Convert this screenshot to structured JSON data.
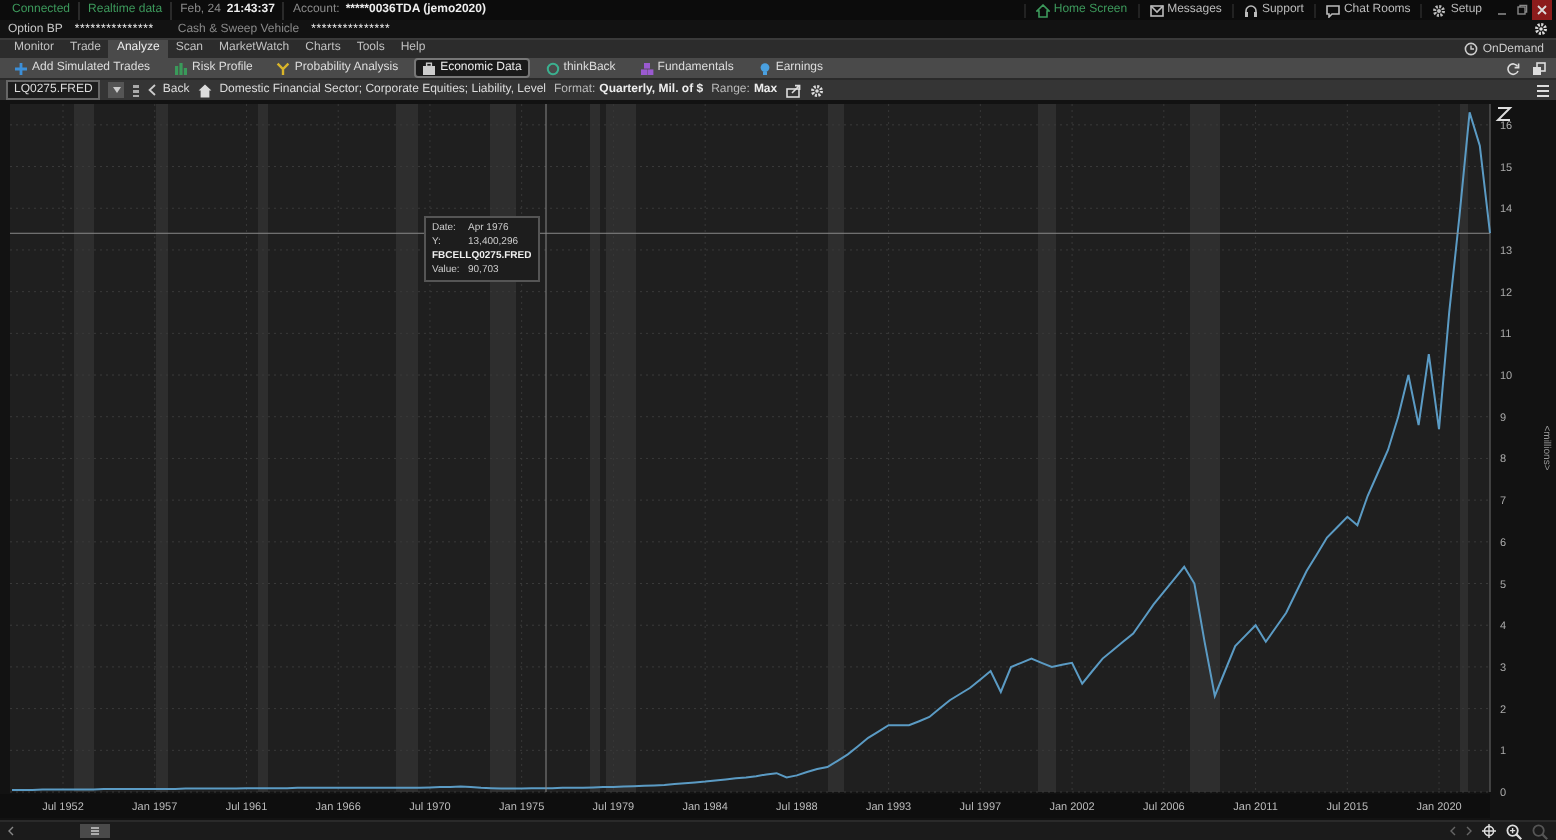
{
  "status_bar": {
    "connection": "Connected",
    "data_feed": "Realtime data",
    "date": "Feb, 24",
    "time": "21:43:37",
    "account_label": "Account:",
    "account": "*****0036TDA (jemo2020)",
    "links": [
      {
        "label": "Home Screen",
        "selected": true
      },
      {
        "label": "Messages",
        "selected": false
      },
      {
        "label": "Support",
        "selected": false
      },
      {
        "label": "Chat Rooms",
        "selected": false
      },
      {
        "label": "Setup",
        "selected": false
      }
    ]
  },
  "account_bar": {
    "fields": [
      {
        "label": "Option BP",
        "value": "***************"
      },
      {
        "label": "Cash & Sweep Vehicle",
        "value": "***************"
      }
    ]
  },
  "tabs": [
    {
      "label": "Monitor",
      "selected": false
    },
    {
      "label": "Trade",
      "selected": false
    },
    {
      "label": "Analyze",
      "selected": true
    },
    {
      "label": "Scan",
      "selected": false
    },
    {
      "label": "MarketWatch",
      "selected": false
    },
    {
      "label": "Charts",
      "selected": false
    },
    {
      "label": "Tools",
      "selected": false
    },
    {
      "label": "Help",
      "selected": false
    }
  ],
  "ondemand": "OnDemand",
  "subtabs": [
    {
      "label": "Add Simulated Trades",
      "selected": false
    },
    {
      "label": "Risk Profile",
      "selected": false
    },
    {
      "label": "Probability Analysis",
      "selected": false
    },
    {
      "label": "Economic Data",
      "selected": true
    },
    {
      "label": "thinkBack",
      "selected": false
    },
    {
      "label": "Fundamentals",
      "selected": false
    },
    {
      "label": "Earnings",
      "selected": false
    }
  ],
  "symbol_bar": {
    "symbol": "LQ0275.FRED",
    "back": "Back",
    "series_title": "Domestic Financial Sector; Corporate Equities; Liability, Level",
    "format_label": "Format:",
    "format": "Quarterly, Mil. of $",
    "range_label": "Range:",
    "range": "Max"
  },
  "chart": {
    "y_unit": "<millions>",
    "tooltip": [
      {
        "kind": "pair",
        "label": "Date:",
        "value": "Apr 1976"
      },
      {
        "kind": "pair",
        "label": "Y:",
        "value": "13,400,296"
      },
      {
        "kind": "series"
      },
      {
        "kind": "pair",
        "label": "Value:",
        "value": "90,703"
      }
    ],
    "chart_data": {
      "type": "line",
      "categories": [
        null,
        null,
        null,
        null,
        null,
        "Jul 1952",
        null,
        null,
        null,
        null,
        null,
        null,
        null,
        null,
        "Jan 1957",
        null,
        null,
        null,
        null,
        null,
        null,
        null,
        null,
        "Jul 1961",
        null,
        null,
        null,
        null,
        null,
        null,
        null,
        null,
        "Jan 1966",
        null,
        null,
        null,
        null,
        null,
        null,
        null,
        null,
        "Jul 1970",
        null,
        null,
        null,
        null,
        null,
        null,
        null,
        null,
        "Jan 1975",
        null,
        null,
        null,
        null,
        null,
        null,
        null,
        null,
        "Jul 1979",
        null,
        null,
        null,
        null,
        null,
        null,
        null,
        null,
        "Jan 1984",
        null,
        null,
        null,
        null,
        null,
        null,
        null,
        null,
        "Jul 1988",
        null,
        null,
        null,
        null,
        null,
        null,
        null,
        null,
        "Jan 1993",
        null,
        null,
        null,
        null,
        null,
        null,
        null,
        null,
        "Jul 1997",
        null,
        null,
        null,
        null,
        null,
        null,
        null,
        null,
        "Jan 2002",
        null,
        null,
        null,
        null,
        null,
        null,
        null,
        null,
        "Jul 2006",
        null,
        null,
        null,
        null,
        null,
        null,
        null,
        null,
        "Jan 2011",
        null,
        null,
        null,
        null,
        null,
        null,
        null,
        null,
        "Jul 2015",
        null,
        null,
        null,
        null,
        null,
        null,
        null,
        null,
        "Jan 2020",
        null,
        null,
        null,
        null,
        null
      ],
      "series": [
        {
          "name": "FBCELLQ0275.FRED",
          "color": "#5b9bc4",
          "values": [
            0.05,
            0.05,
            0.05,
            0.06,
            0.06,
            0.06,
            0.06,
            0.06,
            0.06,
            0.07,
            0.07,
            0.07,
            0.07,
            0.07,
            0.07,
            0.07,
            0.07,
            0.08,
            0.08,
            0.08,
            0.08,
            0.08,
            0.08,
            0.09,
            0.09,
            0.09,
            0.09,
            0.09,
            0.1,
            0.1,
            0.1,
            0.1,
            0.1,
            0.1,
            0.1,
            0.1,
            0.1,
            0.1,
            0.1,
            0.1,
            0.1,
            0.11,
            0.12,
            0.12,
            0.13,
            0.12,
            0.1,
            0.09,
            0.08,
            0.08,
            0.08,
            0.09,
            0.09,
            0.09,
            0.1,
            0.1,
            0.1,
            0.11,
            0.12,
            0.12,
            0.13,
            0.14,
            0.15,
            0.16,
            0.17,
            0.19,
            0.21,
            0.23,
            0.25,
            0.28,
            0.3,
            0.33,
            0.35,
            0.38,
            0.42,
            0.45,
            0.35,
            0.4,
            0.48,
            0.55,
            0.6,
            0.75,
            0.9,
            1.1,
            1.3,
            1.45,
            1.6,
            1.6,
            1.6,
            1.7,
            1.8,
            2.0,
            2.2,
            2.35,
            2.5,
            2.7,
            2.9,
            2.4,
            3.0,
            3.1,
            3.2,
            3.1,
            3.0,
            3.05,
            3.1,
            2.6,
            2.9,
            3.2,
            3.4,
            3.6,
            3.8,
            4.15,
            4.5,
            4.8,
            5.1,
            5.4,
            5.0,
            3.6,
            2.3,
            2.9,
            3.5,
            3.75,
            4.0,
            3.6,
            3.95,
            4.3,
            4.8,
            5.3,
            5.7,
            6.1,
            6.35,
            6.6,
            6.4,
            7.1,
            7.65,
            8.2,
            9.0,
            10.0,
            8.8,
            10.5,
            8.7,
            11.5,
            13.8,
            16.3,
            15.5,
            13.4
          ]
        }
      ],
      "ylim": [
        0,
        16.5
      ],
      "yticks": [
        0,
        1,
        2,
        3,
        4,
        5,
        6,
        7,
        8,
        9,
        10,
        11,
        12,
        13,
        14,
        15,
        16
      ],
      "ref_lines": [
        {
          "axis": "y",
          "value": 13.4
        }
      ],
      "grid": true
    }
  }
}
